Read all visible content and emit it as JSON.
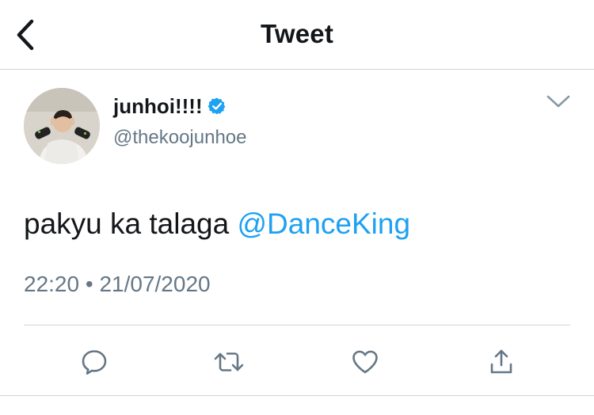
{
  "header": {
    "title": "Tweet",
    "back_icon": "chevron-left-icon"
  },
  "tweet": {
    "author": {
      "display_name": "junhoi!!!!",
      "handle": "@thekoojunhoe",
      "verified": true
    },
    "text_prefix": "pakyu ka talaga ",
    "mention": "@DanceKing",
    "time": "22:20",
    "separator": " • ",
    "date": "21/07/2020"
  },
  "actions": [
    {
      "name": "reply",
      "icon": "reply-bubble-icon"
    },
    {
      "name": "retweet",
      "icon": "retweet-icon"
    },
    {
      "name": "like",
      "icon": "heart-icon"
    },
    {
      "name": "share",
      "icon": "share-icon"
    }
  ],
  "colors": {
    "brand_blue": "#1da1f2",
    "icon_gray": "#657786",
    "text_dark": "#14171a",
    "divider": "#cfd4d9"
  }
}
